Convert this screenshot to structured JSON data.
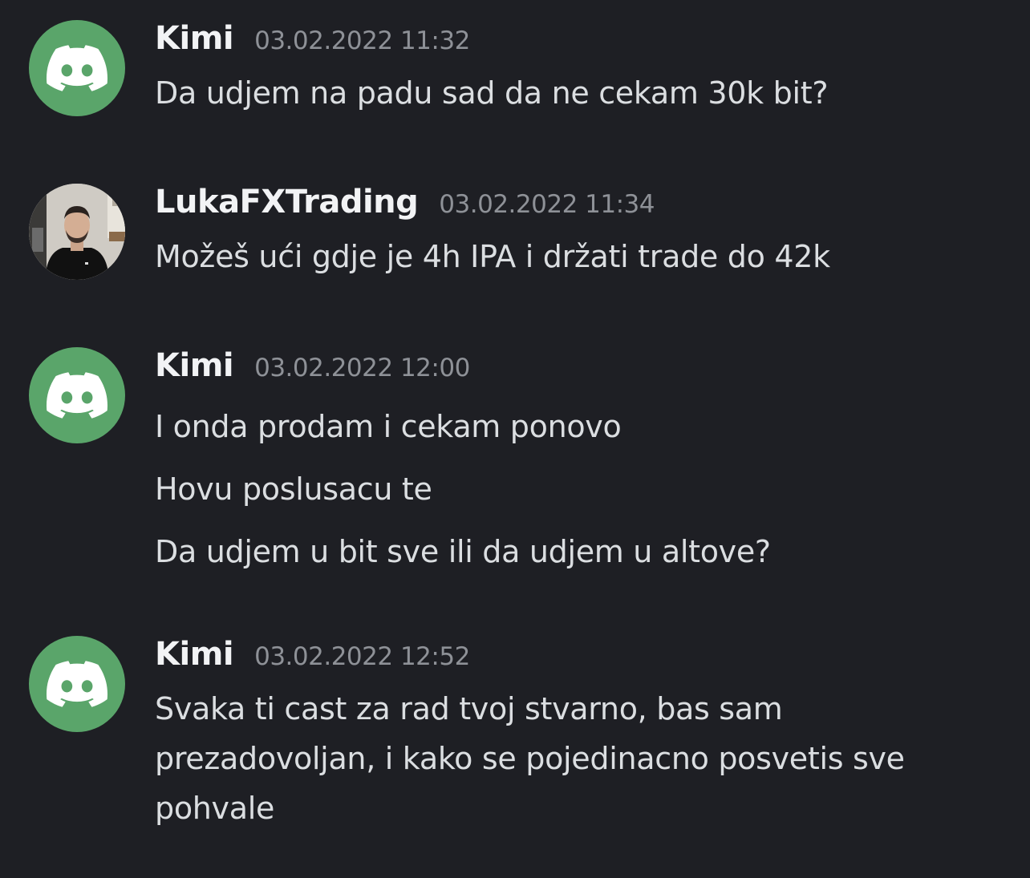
{
  "messages": [
    {
      "author": "Kimi",
      "avatar": "discord-default-avatar",
      "timestamp": "03.02.2022 11:32",
      "lines": [
        "Da udjem na padu sad da ne cekam 30k bit?"
      ]
    },
    {
      "author": "LukaFXTrading",
      "avatar": "user-photo-avatar",
      "timestamp": "03.02.2022 11:34",
      "lines": [
        "Možeš ući gdje je 4h IPA i držati trade do 42k"
      ]
    },
    {
      "author": "Kimi",
      "avatar": "discord-default-avatar",
      "timestamp": "03.02.2022 12:00",
      "lines": [
        "I onda prodam i cekam ponovo",
        "Hovu poslusacu te",
        "Da udjem u bit sve ili da udjem u altove?"
      ]
    },
    {
      "author": "Kimi",
      "avatar": "discord-default-avatar",
      "timestamp": "03.02.2022 12:52",
      "lines": [
        "Svaka ti cast za rad tvoj stvarno, bas sam prezadovoljan, i kako se pojedinacno posvetis sve pohvale"
      ]
    }
  ],
  "colors": {
    "background": "#1e1f24",
    "discord_avatar": "#5aa56a",
    "author": "#f2f3f5",
    "timestamp": "#8e9197",
    "text": "#dbdee1"
  }
}
